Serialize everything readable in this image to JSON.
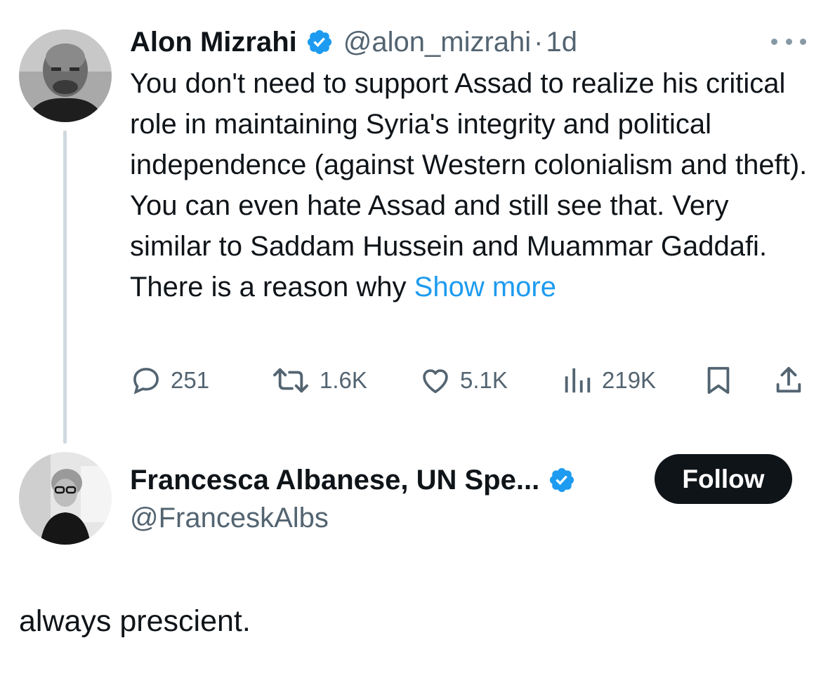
{
  "tweet": {
    "author": {
      "display_name": "Alon Mizrahi",
      "handle": "@alon_mizrahi",
      "verified_icon": "verified-badge-icon",
      "avatar_icon": "avatar"
    },
    "separator": "·",
    "time": "1d",
    "text": "You don't need to support Assad to realize his critical role in maintaining Syria's integrity and political independence (against Western colonialism and theft). You can even hate Assad and still see that. Very similar to Saddam Hussein and Muammar Gaddafi. There is a reason why",
    "show_more": "Show more",
    "more_icon": "more-options-icon",
    "actions": {
      "reply_count": "251",
      "retweet_count": "1.6K",
      "like_count": "5.1K",
      "views_count": "219K"
    }
  },
  "reply": {
    "author": {
      "display_name": "Francesca Albanese, UN Spe...",
      "handle": "@FranceskAlbs",
      "verified_icon": "verified-badge-icon"
    },
    "follow_label": "Follow",
    "comment": "always prescient."
  },
  "colors": {
    "accent": "#1d9bf0",
    "secondary_text": "#536471",
    "primary_text": "#0f1419",
    "thread_line": "#cfd9de",
    "follow_button": "#0f1419"
  }
}
